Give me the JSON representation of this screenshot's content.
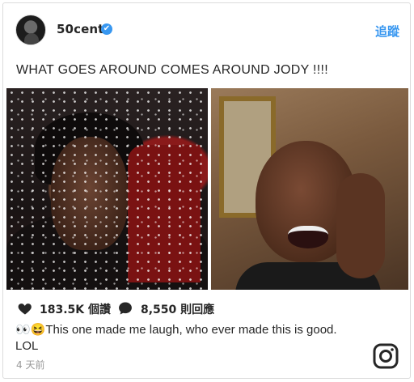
{
  "post": {
    "username": "50cent",
    "verified_mark": "✔",
    "follow_label": "追蹤",
    "headline": "WHAT GOES AROUND COMES AROUND JODY !!!!",
    "likes_count": "183.5K",
    "likes_label": "個讚",
    "comments_count": "8,550",
    "comments_label": "則回應",
    "caption_emoji": "👀😆",
    "caption_text": "This one made me laugh, who ever made this is good. LOL",
    "timestamp": "4 天前"
  },
  "icons": {
    "like": "heart-icon",
    "comment": "comment-bubble-icon",
    "instagram": "instagram-logo-icon",
    "verified": "verified-badge-icon"
  },
  "colors": {
    "link_blue": "#3897f0",
    "text": "#262626",
    "muted": "#999999",
    "border": "#dbdbdb"
  }
}
